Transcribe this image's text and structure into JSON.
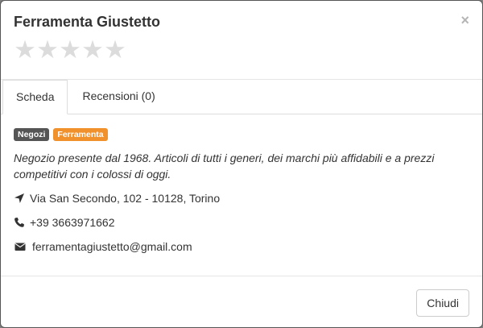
{
  "header": {
    "title": "Ferramenta Giustetto",
    "close_label": "×",
    "rating": {
      "value": 0,
      "max": 5
    }
  },
  "tabs": [
    {
      "label": "Scheda",
      "active": true
    },
    {
      "label": "Recensioni (0)",
      "active": false
    }
  ],
  "content": {
    "badges": [
      {
        "label": "Negozi",
        "color": "#555555"
      },
      {
        "label": "Ferramenta",
        "color": "#f0912b"
      }
    ],
    "description": "Negozio presente dal 1968. Articoli di tutti i generi, dei marchi più affidabili e a prezzi competitivi con i colossi di oggi.",
    "address": {
      "icon": "location-arrow-icon",
      "text": "Via San Secondo, 102 - 10128, Torino"
    },
    "phone": {
      "icon": "phone-icon",
      "text": "+39 3663971662"
    },
    "email": {
      "icon": "envelope-icon",
      "text": "ferramentagiustetto@gmail.com"
    }
  },
  "footer": {
    "close_button_label": "Chiudi"
  }
}
